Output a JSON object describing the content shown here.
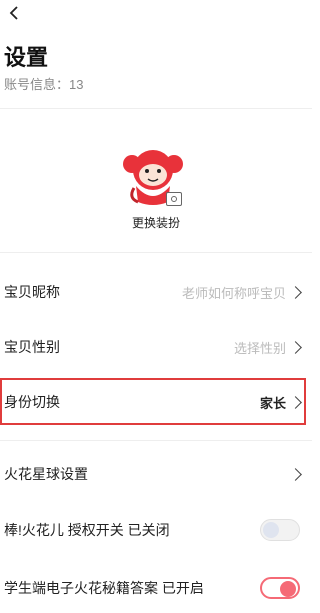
{
  "header": {
    "title": "设置",
    "account_info": "账号信息：13"
  },
  "profile": {
    "change_outfit_label": "更换装扮"
  },
  "settings": {
    "nickname": {
      "label": "宝贝昵称",
      "value": "老师如何称呼宝贝"
    },
    "gender": {
      "label": "宝贝性别",
      "value": "选择性别"
    },
    "identity": {
      "label": "身份切换",
      "value": "家长"
    },
    "planet": {
      "label": "火花星球设置"
    },
    "praise": {
      "label": "棒!火花儿 授权开关  已关闭",
      "enabled": false
    },
    "answers": {
      "label": "学生端电子火花秘籍答案  已开启",
      "enabled": true
    }
  },
  "colors": {
    "highlight_border": "#e03c3c",
    "toggle_on": "#f56a76",
    "mascot_red": "#e8323a"
  }
}
